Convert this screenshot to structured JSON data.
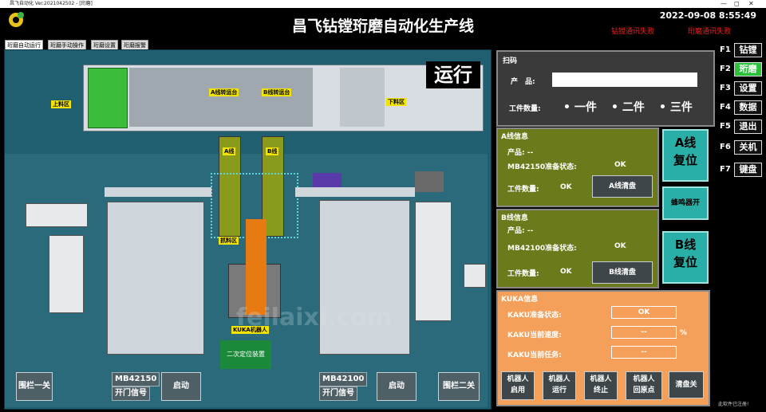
{
  "window": {
    "title": "昌飞自动化 Ver.2021042502 - [珩磨]",
    "controls": [
      "—",
      "◻",
      "✕"
    ]
  },
  "header": {
    "title": "昌飞钻镗珩磨自动化生产线",
    "datetime": "2022-09-08 8:55:49",
    "errors": [
      "钻镗通讯失败",
      "珩磨通讯失败"
    ]
  },
  "tabs": [
    "珩磨自动运行",
    "珩磨手动操作",
    "珩磨设置",
    "珩磨报警"
  ],
  "main": {
    "status": "运行",
    "labels": {
      "load": "上料区",
      "unload": "下料区",
      "a_transfer": "A线转运台",
      "b_transfer": "B线转运台",
      "a_line": "A线",
      "b_line": "B线",
      "pick": "抓料区",
      "kuka": "KUKA机器人",
      "locator": "二次定位装置"
    },
    "machines": {
      "left": "MB42150",
      "right": "MB42100",
      "door_signal": "开门信号"
    },
    "buttons": {
      "fence1": "围栏一关",
      "start1": "启动",
      "start2": "启动",
      "fence2": "围栏二关"
    },
    "watermark": "feilaixi.com"
  },
  "scan": {
    "title": "扫码",
    "product_label": "产　品:",
    "product_value": "",
    "count_label": "工件数量:",
    "options": [
      "• 一件",
      "• 二件",
      "• 三件"
    ]
  },
  "line_a": {
    "title": "A线信息",
    "product": "产品: --",
    "ready_label": "MB42150准备状态:",
    "ready_value": "OK",
    "count_label": "工件数量:",
    "count_value": "OK",
    "clear": "A线清盘"
  },
  "line_b": {
    "title": "B线信息",
    "product": "产品: --",
    "ready_label": "MB42100准备状态:",
    "ready_value": "OK",
    "count_label": "工件数量:",
    "count_value": "OK",
    "clear": "B线清盘"
  },
  "reset_a": "A线\n复位",
  "reset_b": "B线\n复位",
  "buzzer": "蜂鸣器开",
  "kuka": {
    "title": "KUKA信息",
    "ready_label": "KAKU准备状态:",
    "ready_value": "OK",
    "speed_label": "KAKU当前速度:",
    "speed_value": "--",
    "speed_unit": "%",
    "task_label": "KAKU当前任务:",
    "task_value": "--",
    "buttons": [
      "机器人\n启用",
      "机器人\n运行",
      "机器人\n终止",
      "机器人\n回原点",
      "清盘关"
    ]
  },
  "fkeys": [
    {
      "key": "F1",
      "label": "钻镗"
    },
    {
      "key": "F2",
      "label": "珩磨"
    },
    {
      "key": "F3",
      "label": "设置"
    },
    {
      "key": "F4",
      "label": "数据"
    },
    {
      "key": "F5",
      "label": "退出"
    },
    {
      "key": "F6",
      "label": "关机"
    },
    {
      "key": "F7",
      "label": "键盘"
    }
  ],
  "footer_note": "此软件已注册!",
  "colors": {
    "accent": "#2bc13a",
    "teal": "#2aaea8",
    "line_panel": "#6b7a1a",
    "kuka_panel": "#f4a05a",
    "scan_panel": "#3a3a3a"
  }
}
